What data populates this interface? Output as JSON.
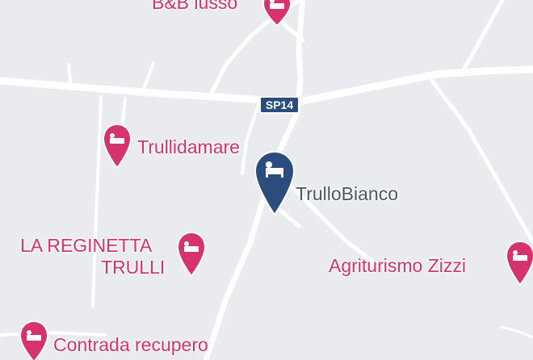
{
  "map": {
    "road_label": "SP14",
    "places": [
      {
        "id": "bb-lusso",
        "name": "B&B lusso",
        "icon": "hotel-icon",
        "color": "#d6336c"
      },
      {
        "id": "trullidamare",
        "name": "Trullidamare",
        "icon": "hotel-icon",
        "color": "#d6336c"
      },
      {
        "id": "trullobianco",
        "name": "TrulloBianco",
        "icon": "hotel-icon",
        "color": "#2b4c7e",
        "selected": true
      },
      {
        "id": "la-reginetta",
        "name_line1": "LA REGINETTA",
        "name_line2": "TRULLI",
        "icon": "hotel-icon",
        "color": "#d6336c"
      },
      {
        "id": "agriturismo-zizzi",
        "name": "Agriturismo Zizzi",
        "icon": "hotel-icon",
        "color": "#d6336c"
      },
      {
        "id": "contrada-recupero",
        "name": "Contrada recupero",
        "icon": "hotel-icon",
        "color": "#d6336c"
      }
    ]
  }
}
